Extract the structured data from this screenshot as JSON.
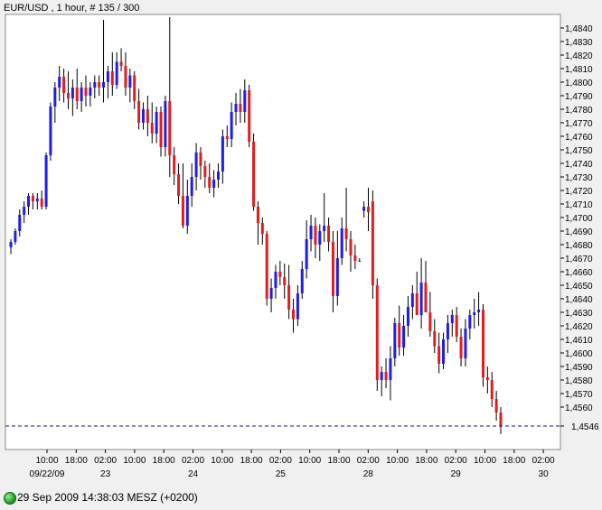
{
  "header": {
    "title": "EUR/USD , 1 hour, # 135 / 300"
  },
  "status": {
    "connection_icon": "connection-status-icon",
    "text": "29 Sep 2009 14:38:03  MESZ (+0200)"
  },
  "colors": {
    "up": "#1e1ee6",
    "down": "#e11e1e",
    "wick": "#000000",
    "last_line": "#1a1a7a"
  },
  "chart_data": {
    "type": "candlestick",
    "title": "EUR/USD , 1 hour, # 135 / 300",
    "ylim": [
      1.4535,
      1.485
    ],
    "yticks": [
      "1,4840",
      "1,4830",
      "1,4820",
      "1,4810",
      "1,4800",
      "1,4790",
      "1,4780",
      "1,4770",
      "1,4760",
      "1,4750",
      "1,4740",
      "1,4730",
      "1,4720",
      "1,4710",
      "1,4700",
      "1,4690",
      "1,4680",
      "1,4670",
      "1,4660",
      "1,4650",
      "1,4640",
      "1,4630",
      "1,4620",
      "1,4610",
      "1,4600",
      "1,4590",
      "1,4580",
      "1,4570",
      "1,4560"
    ],
    "last_price": {
      "value": 1.4546,
      "label": "1,4546"
    },
    "x_time_ticks": [
      "10:00",
      "18:00",
      "02:00",
      "10:00",
      "18:00",
      "02:00",
      "10:00",
      "18:00",
      "02:00",
      "10:00",
      "18:00",
      "02:00",
      "10:00",
      "18:00",
      "02:00",
      "10:00",
      "18:00",
      "02:00"
    ],
    "x_date_labels": [
      "09/22/09",
      "23",
      "24",
      "25",
      "28",
      "29",
      "30"
    ],
    "grid": false,
    "candles": [
      [
        1.4678,
        1.4684,
        1.4673,
        1.4682
      ],
      [
        1.4682,
        1.4692,
        1.468,
        1.469
      ],
      [
        1.469,
        1.4706,
        1.4686,
        1.4702
      ],
      [
        1.4702,
        1.4712,
        1.4696,
        1.4708
      ],
      [
        1.4708,
        1.4718,
        1.4702,
        1.4716
      ],
      [
        1.4716,
        1.4718,
        1.4706,
        1.4712
      ],
      [
        1.4712,
        1.4718,
        1.4706,
        1.4714
      ],
      [
        1.4714,
        1.472,
        1.4706,
        1.4708
      ],
      [
        1.4708,
        1.4748,
        1.4706,
        1.4746
      ],
      [
        1.4746,
        1.4785,
        1.4742,
        1.4782
      ],
      [
        1.4782,
        1.48,
        1.477,
        1.4796
      ],
      [
        1.4796,
        1.4812,
        1.4786,
        1.4804
      ],
      [
        1.4804,
        1.481,
        1.4785,
        1.4792
      ],
      [
        1.4792,
        1.4808,
        1.478,
        1.4788
      ],
      [
        1.4788,
        1.4802,
        1.4775,
        1.4796
      ],
      [
        1.4796,
        1.481,
        1.478,
        1.4786
      ],
      [
        1.4786,
        1.48,
        1.4778,
        1.4796
      ],
      [
        1.4796,
        1.4805,
        1.4782,
        1.479
      ],
      [
        1.479,
        1.48,
        1.4782,
        1.4796
      ],
      [
        1.4796,
        1.4805,
        1.4788,
        1.48
      ],
      [
        1.48,
        1.4805,
        1.479,
        1.4796
      ],
      [
        1.4796,
        1.4846,
        1.4785,
        1.48
      ],
      [
        1.48,
        1.4812,
        1.4788,
        1.4808
      ],
      [
        1.4808,
        1.4822,
        1.479,
        1.4798
      ],
      [
        1.4798,
        1.4822,
        1.4795,
        1.4815
      ],
      [
        1.4815,
        1.4825,
        1.4808,
        1.4812
      ],
      [
        1.4812,
        1.4822,
        1.479,
        1.4796
      ],
      [
        1.4796,
        1.481,
        1.4785,
        1.4805
      ],
      [
        1.4805,
        1.4808,
        1.478,
        1.4786
      ],
      [
        1.4786,
        1.4795,
        1.4765,
        1.477
      ],
      [
        1.477,
        1.4785,
        1.4765,
        1.478
      ],
      [
        1.478,
        1.479,
        1.476,
        1.477
      ],
      [
        1.477,
        1.4785,
        1.4755,
        1.4762
      ],
      [
        1.4762,
        1.4782,
        1.4755,
        1.4778
      ],
      [
        1.4778,
        1.4782,
        1.4745,
        1.4752
      ],
      [
        1.4752,
        1.479,
        1.4745,
        1.4786
      ],
      [
        1.4786,
        1.4848,
        1.473,
        1.4746
      ],
      [
        1.4746,
        1.4752,
        1.4724,
        1.4732
      ],
      [
        1.4732,
        1.474,
        1.471,
        1.4716
      ],
      [
        1.4716,
        1.474,
        1.4692,
        1.4694
      ],
      [
        1.4694,
        1.4728,
        1.4688,
        1.4716
      ],
      [
        1.4716,
        1.474,
        1.4708,
        1.473
      ],
      [
        1.473,
        1.4755,
        1.472,
        1.4748
      ],
      [
        1.4748,
        1.4752,
        1.4728,
        1.4738
      ],
      [
        1.4738,
        1.4742,
        1.4722,
        1.473
      ],
      [
        1.473,
        1.474,
        1.4718,
        1.4722
      ],
      [
        1.4722,
        1.4735,
        1.4715,
        1.4728
      ],
      [
        1.4728,
        1.474,
        1.4722,
        1.4734
      ],
      [
        1.4734,
        1.4765,
        1.4725,
        1.476
      ],
      [
        1.476,
        1.4768,
        1.4752,
        1.4758
      ],
      [
        1.4758,
        1.4785,
        1.4752,
        1.4778
      ],
      [
        1.4778,
        1.4792,
        1.4768,
        1.4784
      ],
      [
        1.4784,
        1.4795,
        1.477,
        1.4778
      ],
      [
        1.4778,
        1.4802,
        1.477,
        1.4794
      ],
      [
        1.4794,
        1.4798,
        1.4752,
        1.4756
      ],
      [
        1.4756,
        1.4762,
        1.4705,
        1.4708
      ],
      [
        1.4708,
        1.4712,
        1.468,
        1.4696
      ],
      [
        1.4696,
        1.47,
        1.468,
        1.4688
      ],
      [
        1.4688,
        1.469,
        1.4635,
        1.464
      ],
      [
        1.464,
        1.4655,
        1.463,
        1.4648
      ],
      [
        1.4648,
        1.4665,
        1.464,
        1.466
      ],
      [
        1.466,
        1.4668,
        1.465,
        1.4656
      ],
      [
        1.4656,
        1.4666,
        1.464,
        1.465
      ],
      [
        1.465,
        1.4665,
        1.4625,
        1.4632
      ],
      [
        1.4632,
        1.464,
        1.4615,
        1.4625
      ],
      [
        1.4625,
        1.465,
        1.462,
        1.4644
      ],
      [
        1.4644,
        1.4668,
        1.464,
        1.4662
      ],
      [
        1.4662,
        1.4698,
        1.4655,
        1.4684
      ],
      [
        1.4684,
        1.4702,
        1.4675,
        1.4694
      ],
      [
        1.4694,
        1.47,
        1.467,
        1.468
      ],
      [
        1.468,
        1.4695,
        1.4668,
        1.469
      ],
      [
        1.469,
        1.4718,
        1.4682,
        1.4694
      ],
      [
        1.4694,
        1.47,
        1.4675,
        1.4682
      ],
      [
        1.4682,
        1.469,
        1.463,
        1.4642
      ],
      [
        1.4642,
        1.469,
        1.4635,
        1.467
      ],
      [
        1.467,
        1.47,
        1.4665,
        1.4692
      ],
      [
        1.4692,
        1.4722,
        1.4675,
        1.4684
      ],
      [
        1.4684,
        1.469,
        1.466,
        1.4672
      ],
      [
        1.4672,
        1.468,
        1.4662,
        1.4668
      ],
      [
        1.4668,
        1.467,
        1.4668,
        1.4668
      ],
      [
        1.4705,
        1.4712,
        1.47,
        1.4708
      ],
      [
        1.4708,
        1.4722,
        1.469,
        1.4704
      ],
      [
        1.4712,
        1.472,
        1.464,
        1.465
      ],
      [
        1.465,
        1.4655,
        1.4572,
        1.458
      ],
      [
        1.458,
        1.459,
        1.4568,
        1.4586
      ],
      [
        1.4586,
        1.4596,
        1.4574,
        1.458
      ],
      [
        1.458,
        1.4605,
        1.4565,
        1.4596
      ],
      [
        1.4596,
        1.4626,
        1.459,
        1.4622
      ],
      [
        1.4622,
        1.4635,
        1.4598,
        1.4604
      ],
      [
        1.4604,
        1.4628,
        1.4598,
        1.462
      ],
      [
        1.462,
        1.4642,
        1.4612,
        1.4634
      ],
      [
        1.4634,
        1.465,
        1.4625,
        1.4644
      ],
      [
        1.4644,
        1.466,
        1.4635,
        1.4628
      ],
      [
        1.4628,
        1.467,
        1.4618,
        1.4652
      ],
      [
        1.4652,
        1.4668,
        1.464,
        1.463
      ],
      [
        1.463,
        1.4645,
        1.4612,
        1.4616
      ],
      [
        1.4616,
        1.4625,
        1.46,
        1.4605
      ],
      [
        1.4605,
        1.4615,
        1.4585,
        1.4592
      ],
      [
        1.4592,
        1.4615,
        1.4588,
        1.461
      ],
      [
        1.461,
        1.4628,
        1.46,
        1.4622
      ],
      [
        1.4622,
        1.4632,
        1.4612,
        1.4628
      ],
      [
        1.4628,
        1.4634,
        1.4608,
        1.4612
      ],
      [
        1.4612,
        1.4618,
        1.459,
        1.4596
      ],
      [
        1.4596,
        1.4625,
        1.459,
        1.4618
      ],
      [
        1.4618,
        1.4632,
        1.461,
        1.4628
      ],
      [
        1.4628,
        1.464,
        1.4618,
        1.463
      ],
      [
        1.463,
        1.4645,
        1.462,
        1.4632
      ],
      [
        1.4632,
        1.4636,
        1.4575,
        1.4582
      ],
      [
        1.4582,
        1.459,
        1.457,
        1.458
      ],
      [
        1.458,
        1.4586,
        1.456,
        1.4566
      ],
      [
        1.4566,
        1.4572,
        1.455,
        1.4556
      ],
      [
        1.4556,
        1.456,
        1.454,
        1.4546
      ]
    ]
  }
}
